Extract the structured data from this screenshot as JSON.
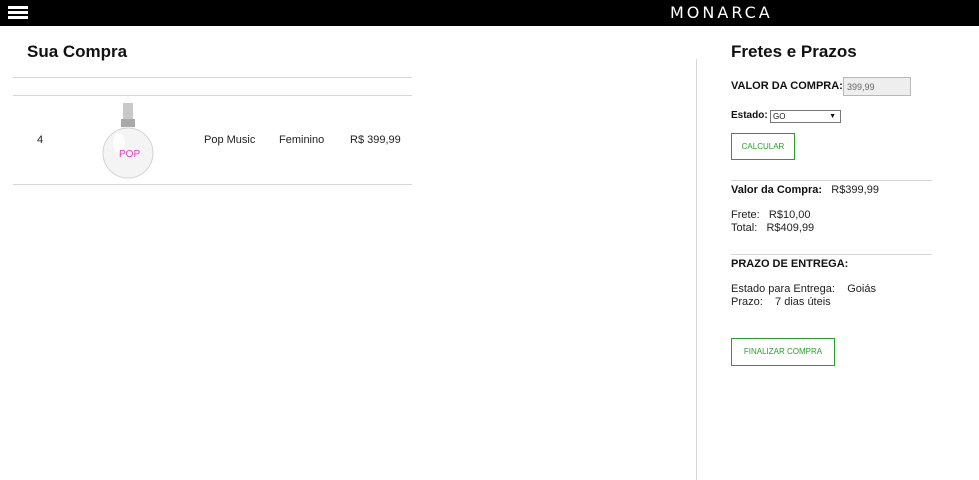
{
  "header": {
    "brand": "MONARCA",
    "menu_icon": "hamburger-menu-icon"
  },
  "cart": {
    "title": "Sua Compra",
    "items": [
      {
        "qty": "4",
        "image_icon": "perfume-bottle-image",
        "image_text": "POP",
        "name": "Pop Music",
        "gender": "Feminino",
        "price": "R$ 399,99"
      }
    ]
  },
  "shipping": {
    "title": "Fretes e Prazos",
    "valor_compra_label": "VALOR DA COMPRA:",
    "valor_compra_value": "399,99",
    "estado_label": "Estado:",
    "estado_selected": "GO",
    "calcular_label": "CALCULAR",
    "summary": {
      "valor_label": "Valor da Compra:",
      "valor_value": "R$399,99",
      "frete_label": "Frete:",
      "frete_value": "R$10,00",
      "total_label": "Total:",
      "total_value": "R$409,99"
    },
    "prazo_title": "PRAZO DE ENTREGA:",
    "estado_entrega_label": "Estado para Entrega:",
    "estado_entrega_value": "Goiás",
    "prazo_label": "Prazo:",
    "prazo_value": "7 dias úteis",
    "finalizar_label": "FINALIZAR COMPRA"
  },
  "colors": {
    "topbar": "#000000",
    "accent_green": "#2aa02a",
    "divider": "#d6d6d6",
    "product_pink": "#e040c8"
  }
}
